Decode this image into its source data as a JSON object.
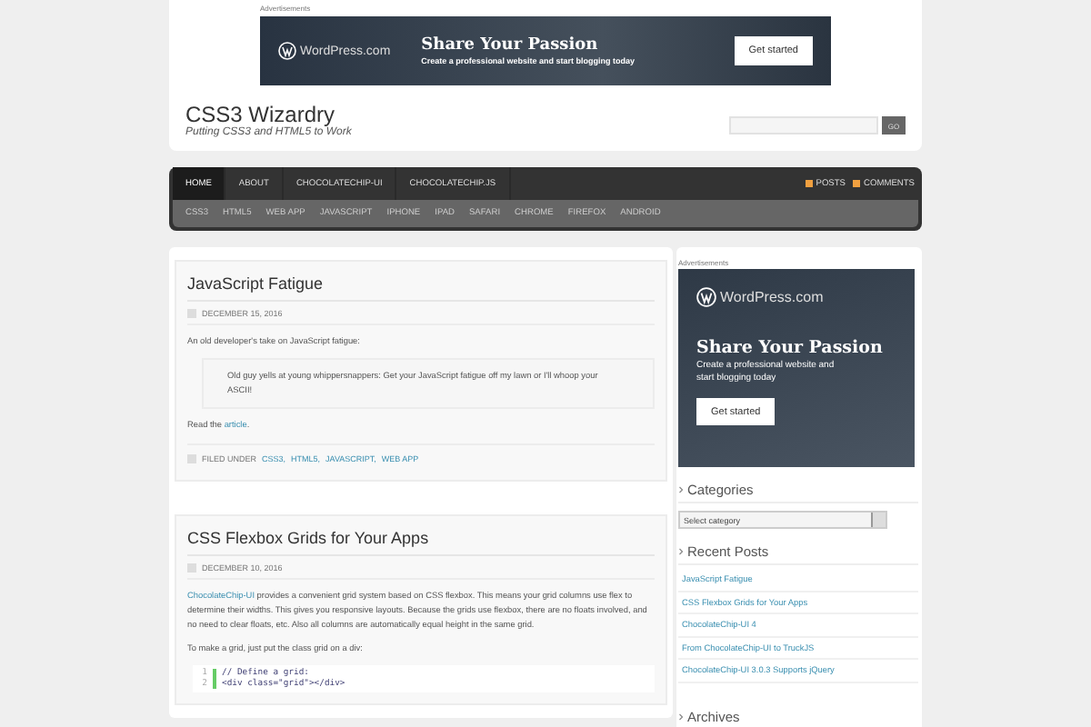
{
  "top_ad": {
    "label": "Advertisements",
    "brand": "WordPress.com",
    "headline": "Share Your Passion",
    "subline": "Create a professional website and start blogging today",
    "button": "Get started"
  },
  "site": {
    "title": "CSS3 Wizardry",
    "tagline": "Putting CSS3 and HTML5 to Work",
    "search_button": "GO"
  },
  "nav": {
    "items": [
      {
        "label": "HOME",
        "selected": true
      },
      {
        "label": "ABOUT",
        "selected": false
      },
      {
        "label": "CHOCOLATECHIP-UI",
        "selected": false
      },
      {
        "label": "CHOCOLATECHIP.JS",
        "selected": false
      }
    ],
    "feeds": [
      "POSTS",
      "COMMENTS"
    ],
    "categories": [
      "CSS3",
      "HTML5",
      "WEB APP",
      "JAVASCRIPT",
      "IPHONE",
      "IPAD",
      "SAFARI",
      "CHROME",
      "FIREFOX",
      "ANDROID"
    ]
  },
  "posts": [
    {
      "title": "JavaScript Fatigue",
      "date": "DECEMBER 15, 2016",
      "body": [
        {
          "kind": "paragraph",
          "text": "An old developer's take on JavaScript fatigue:"
        },
        {
          "kind": "quote",
          "text": "Old guy yells at young whippersnappers: Get your JavaScript fatigue off my lawn or I'll whoop your ASCII!"
        },
        {
          "kind": "paragraph",
          "before": "Read the ",
          "link": "article",
          "after": "."
        }
      ],
      "filed_label": "FILED UNDER",
      "tags": [
        "CSS3,",
        "HTML5,",
        "JAVASCRIPT,",
        "WEB APP"
      ]
    },
    {
      "title": "CSS Flexbox Grids for Your Apps",
      "date": "DECEMBER 10, 2016",
      "body": [
        {
          "kind": "paragraph",
          "link": "ChocolateChip-UI",
          "after": " provides a convenient grid system based on CSS flexbox. This means your grid columns use flex to determine their widths. This gives you responsive layouts. Because the grids use flexbox, there are no floats involved, and no need to clear floats, etc. Also all columns are automatically equal height in the same grid."
        },
        {
          "kind": "paragraph",
          "text": "To make a grid, just put the class grid on a div:"
        },
        {
          "kind": "code",
          "lines": [
            {
              "number": "1",
              "text": "// Define a grid:"
            },
            {
              "number": "2",
              "text": "<div class=\"grid\"></div>"
            }
          ]
        }
      ]
    }
  ],
  "sidebar": {
    "ad": {
      "label": "Advertisements",
      "brand": "WordPress.com",
      "headline": "Share Your Passion",
      "subline": "Create a professional website and start blogging today",
      "button": "Get started"
    },
    "categories": {
      "heading": "Categories",
      "select": "Select category"
    },
    "recent": {
      "heading": "Recent Posts",
      "items": [
        "JavaScript Fatigue",
        "CSS Flexbox Grids for Your Apps",
        "ChocolateChip-UI 4",
        "From ChocolateChip-UI to TruckJS",
        "ChocolateChip-UI 3.0.3 Supports jQuery"
      ]
    },
    "archives": {
      "heading": "Archives"
    }
  }
}
